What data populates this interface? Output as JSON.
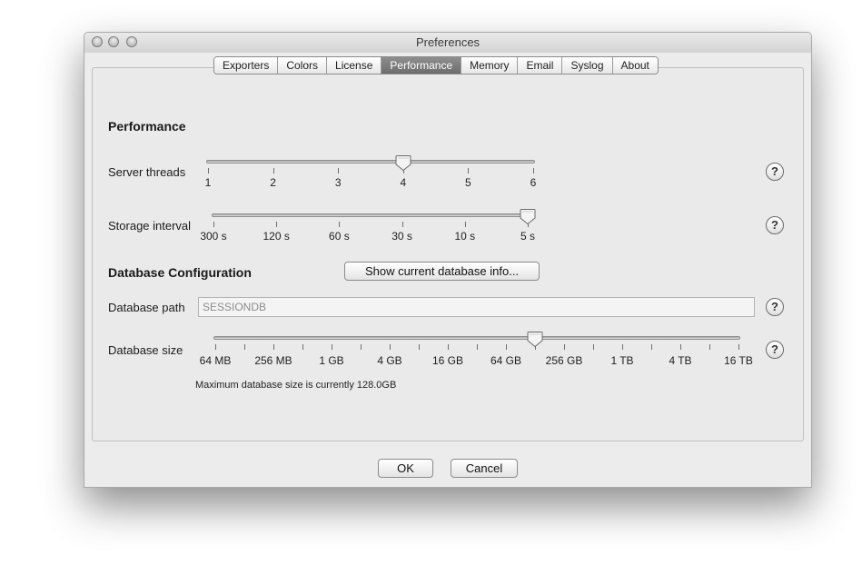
{
  "window": {
    "title": "Preferences"
  },
  "tabs": [
    {
      "label": "Exporters",
      "name": "tab-exporters",
      "active": false
    },
    {
      "label": "Colors",
      "name": "tab-colors",
      "active": false
    },
    {
      "label": "License",
      "name": "tab-license",
      "active": false
    },
    {
      "label": "Performance",
      "name": "tab-performance",
      "active": true
    },
    {
      "label": "Memory",
      "name": "tab-memory",
      "active": false
    },
    {
      "label": "Email",
      "name": "tab-email",
      "active": false
    },
    {
      "label": "Syslog",
      "name": "tab-syslog",
      "active": false
    },
    {
      "label": "About",
      "name": "tab-about",
      "active": false
    }
  ],
  "performance": {
    "title": "Performance",
    "server_threads": {
      "label": "Server threads",
      "ticks": [
        "1",
        "2",
        "3",
        "4",
        "5",
        "6"
      ],
      "selected_index": 3
    },
    "storage_interval": {
      "label": "Storage interval",
      "ticks": [
        "300 s",
        "120 s",
        "60 s",
        "30 s",
        "10 s",
        "5 s"
      ],
      "selected_index": 5
    }
  },
  "database": {
    "title": "Database Configuration",
    "show_info_button": "Show current database info...",
    "path_label": "Database path",
    "path_value": "SESSIONDB",
    "size": {
      "label": "Database size",
      "labels": [
        "64 MB",
        "256 MB",
        "1 GB",
        "4 GB",
        "16 GB",
        "64 GB",
        "256 GB",
        "1 TB",
        "4 TB",
        "16 TB"
      ],
      "minor_ticks": 19,
      "selected_index": 11,
      "note": "Maximum database size is currently 128.0GB"
    }
  },
  "help_glyph": "?",
  "buttons": {
    "ok": "OK",
    "cancel": "Cancel"
  },
  "icons": {
    "close": "close-icon",
    "minimize": "minimize-icon",
    "zoom": "zoom-icon",
    "help": "help-icon",
    "slider_thumb": "slider-thumb-icon"
  }
}
